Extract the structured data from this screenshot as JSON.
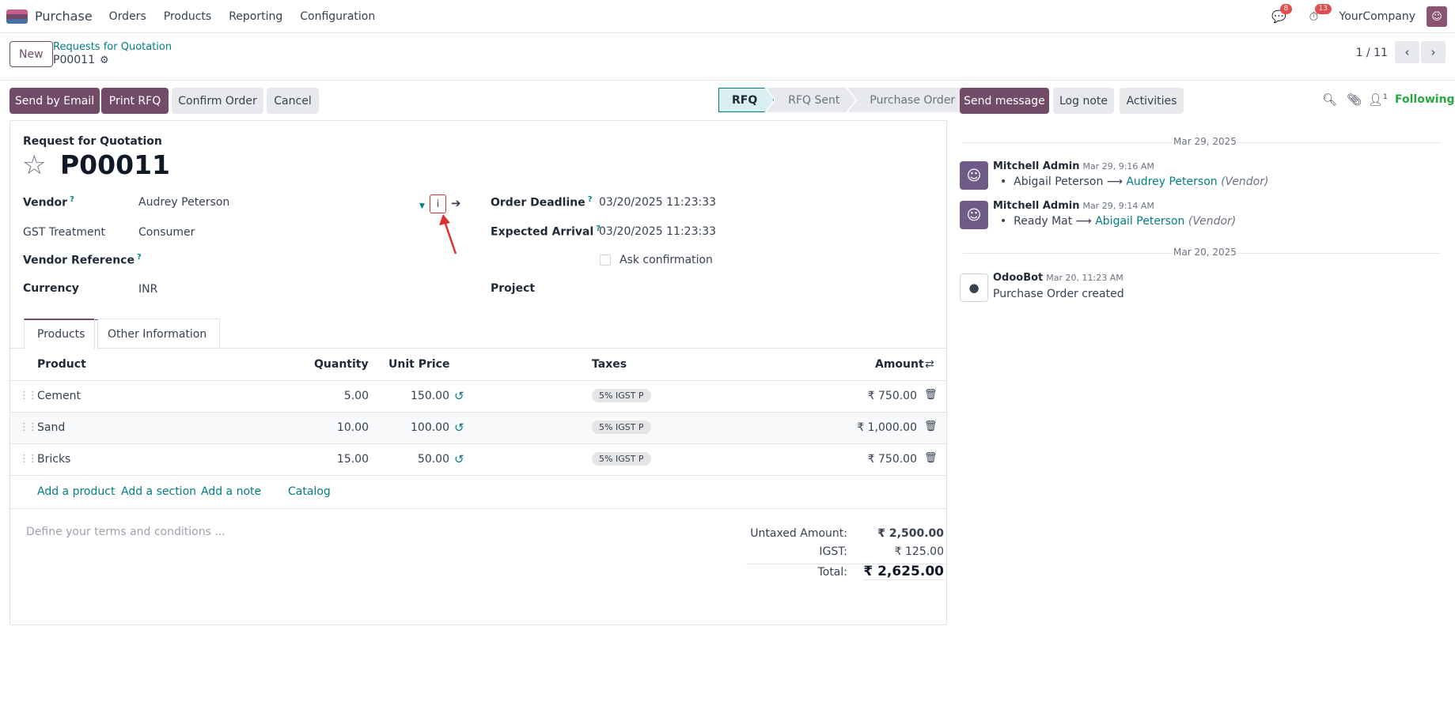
{
  "navbar": {
    "app_name": "Purchase",
    "menu": [
      "Orders",
      "Products",
      "Reporting",
      "Configuration"
    ],
    "messages_badge": "8",
    "activities_badge": "13",
    "company": "YourCompany"
  },
  "control": {
    "new_label": "New",
    "breadcrumb": "Requests for Quotation",
    "record": "P00011",
    "pager": "1 / 11"
  },
  "actions": {
    "send_email": "Send by Email",
    "print_rfq": "Print RFQ",
    "confirm": "Confirm Order",
    "cancel": "Cancel"
  },
  "status": {
    "stages": [
      "RFQ",
      "RFQ Sent",
      "Purchase Order"
    ],
    "current": "RFQ"
  },
  "chatter_buttons": {
    "send_message": "Send message",
    "log_note": "Log note",
    "activities": "Activities",
    "followers_count": "1",
    "following": "Following"
  },
  "form": {
    "subtitle": "Request for Quotation",
    "title": "P00011",
    "vendor_label": "Vendor",
    "vendor_value": "Audrey Peterson",
    "info_label": "i",
    "gst_label": "GST Treatment",
    "gst_value": "Consumer",
    "vendor_ref_label": "Vendor Reference",
    "currency_label": "Currency",
    "currency_value": "INR",
    "order_deadline_label": "Order Deadline",
    "order_deadline_value": "03/20/2025 11:23:33",
    "expected_arrival_label": "Expected Arrival",
    "expected_arrival_value": "03/20/2025 11:23:33",
    "ask_confirmation_label": "Ask confirmation",
    "project_label": "Project",
    "help_mark": "?"
  },
  "tabs": [
    "Products",
    "Other Information"
  ],
  "table": {
    "headers": {
      "product": "Product",
      "quantity": "Quantity",
      "unit_price": "Unit Price",
      "taxes": "Taxes",
      "amount": "Amount"
    },
    "rows": [
      {
        "product": "Cement",
        "quantity": "5.00",
        "unit_price": "150.00",
        "tax": "5% IGST P",
        "amount": "₹ 750.00"
      },
      {
        "product": "Sand",
        "quantity": "10.00",
        "unit_price": "100.00",
        "tax": "5% IGST P",
        "amount": "₹ 1,000.00"
      },
      {
        "product": "Bricks",
        "quantity": "15.00",
        "unit_price": "50.00",
        "tax": "5% IGST P",
        "amount": "₹ 750.00"
      }
    ],
    "add_product": "Add a product",
    "add_section": "Add a section",
    "add_note": "Add a note",
    "catalog": "Catalog"
  },
  "terms_placeholder": "Define your terms and conditions ...",
  "totals": {
    "untaxed_label": "Untaxed Amount:",
    "untaxed_value": "₹ 2,500.00",
    "igst_label": "IGST:",
    "igst_value": "₹ 125.00",
    "total_label": "Total:",
    "total_value": "₹ 2,625.00"
  },
  "chatter": {
    "date1": "Mar 29, 2025",
    "msg1_author": "Mitchell Admin",
    "msg1_time": "Mar 29, 9:16 AM",
    "msg1_old": "Abigail Peterson",
    "msg1_new": "Audrey Peterson",
    "msg1_field": "(Vendor)",
    "msg2_author": "Mitchell Admin",
    "msg2_time": "Mar 29, 9:14 AM",
    "msg2_old": "Ready Mat",
    "msg2_new": "Abigail Peterson",
    "msg2_field": "(Vendor)",
    "date2": "Mar 20, 2025",
    "msg3_author": "OdooBot",
    "msg3_time": "Mar 20, 11:23 AM",
    "msg3_body": "Purchase Order created"
  },
  "colors": {
    "primary": "#714b67",
    "link": "#017e84",
    "annotation_arrow": "#e03131"
  }
}
